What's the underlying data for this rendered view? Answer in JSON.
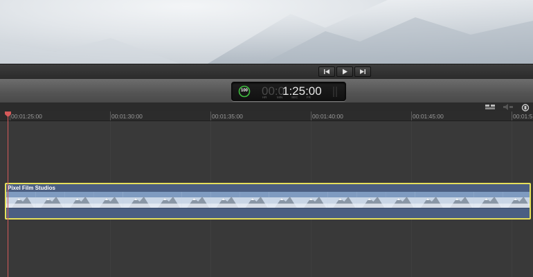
{
  "transport": {
    "buttons": [
      "skip-back",
      "play",
      "skip-forward"
    ]
  },
  "dashboard": {
    "render_percent": "100",
    "timecode_dim": "00:0",
    "timecode_lit": "1:25:00",
    "units": [
      "HR",
      "MIN",
      "SEC",
      "FR"
    ]
  },
  "ruler": {
    "labels": [
      "00:01:25:00",
      "00:01:30:00",
      "00:01:35:00",
      "00:01:40:00",
      "00:01:45:00",
      "00:01:5"
    ]
  },
  "clip": {
    "title": "Pixel Film Studios",
    "selected": true
  },
  "colors": {
    "clip_body": "#4b5f82",
    "clip_selection": "#e6e05a",
    "playhead": "#d65a5a",
    "render_ring": "#3fbf3f"
  },
  "icons": [
    "skip-back-icon",
    "play-icon",
    "skip-forward-icon",
    "clip-appearance-icon",
    "audio-skimming-icon",
    "snapping-icon",
    "playhead-marker-icon"
  ]
}
